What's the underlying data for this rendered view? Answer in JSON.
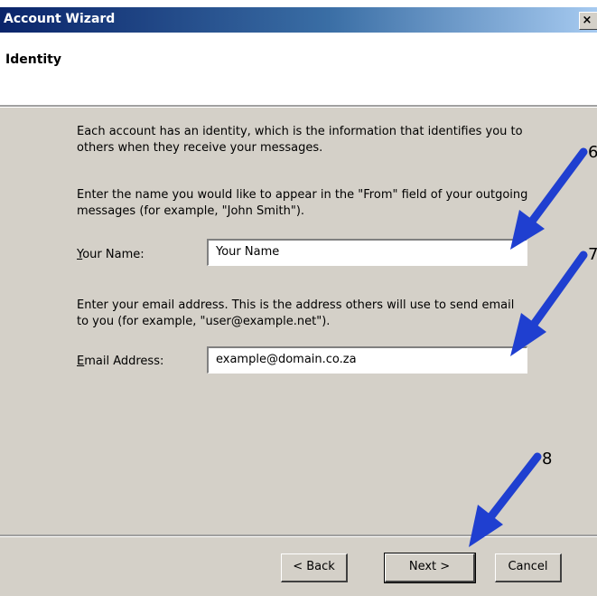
{
  "window": {
    "title": "Account Wizard",
    "close_glyph": "×"
  },
  "header": {
    "title": "Identity"
  },
  "body": {
    "intro": "Each account has an identity, which is the information that identifies you to others when they receive your messages.",
    "name_instructions": "Enter the name you would like to appear in the \"From\" field of your outgoing messages (for example, \"John Smith\").",
    "name_label_mnemonic": "Y",
    "name_label_rest": "our Name:",
    "name_value": "Your Name",
    "email_instructions": "Enter your email address. This is the address others will use to send email to you (for example, \"user@example.net\").",
    "email_label_mnemonic": "E",
    "email_label_rest": "mail Address:",
    "email_value": "example@domain.co.za"
  },
  "buttons": {
    "back": "< Back",
    "next": "Next >",
    "cancel": "Cancel"
  },
  "annotations": {
    "arrow_color": "#1f3fd0",
    "callout_6": "6",
    "callout_7": "7",
    "callout_8": "8"
  }
}
